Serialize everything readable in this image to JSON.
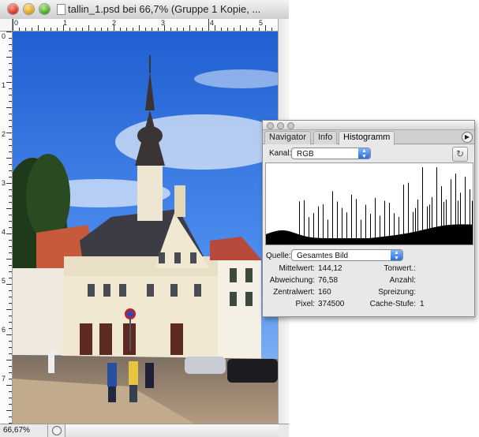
{
  "window": {
    "title": "tallin_1.psd bei 66,7% (Gruppe 1 Kopie, ..."
  },
  "rulers": {
    "top": [
      "0",
      "1",
      "2",
      "3",
      "4",
      "5"
    ],
    "left": [
      "0",
      "1",
      "2",
      "3",
      "4",
      "5",
      "6",
      "7"
    ]
  },
  "statusbar": {
    "zoom": "66,67%"
  },
  "histogram_palette": {
    "tabs": [
      {
        "label": "Navigator",
        "active": false
      },
      {
        "label": "Info",
        "active": false
      },
      {
        "label": "Histogramm",
        "active": true
      }
    ],
    "channel_label": "Kanal:",
    "channel_value": "RGB",
    "source_label": "Quelle:",
    "source_value": "Gesamtes Bild",
    "stats_left": [
      {
        "label": "Mittelwert:",
        "value": "144,12"
      },
      {
        "label": "Abweichung:",
        "value": "76,58"
      },
      {
        "label": "Zentralwert:",
        "value": "160"
      },
      {
        "label": "Pixel:",
        "value": "374500"
      }
    ],
    "stats_right": [
      {
        "label": "Tonwert.:",
        "value": ""
      },
      {
        "label": "Anzahl:",
        "value": ""
      },
      {
        "label": "Spreizung:",
        "value": ""
      },
      {
        "label": "Cache-Stufe:",
        "value": "1"
      }
    ]
  },
  "icons": {
    "close": "close-icon",
    "minimize": "minimize-icon",
    "zoom": "zoom-icon",
    "document": "document-icon",
    "refresh": "refresh-icon",
    "palette_menu": "palette-menu-icon"
  }
}
